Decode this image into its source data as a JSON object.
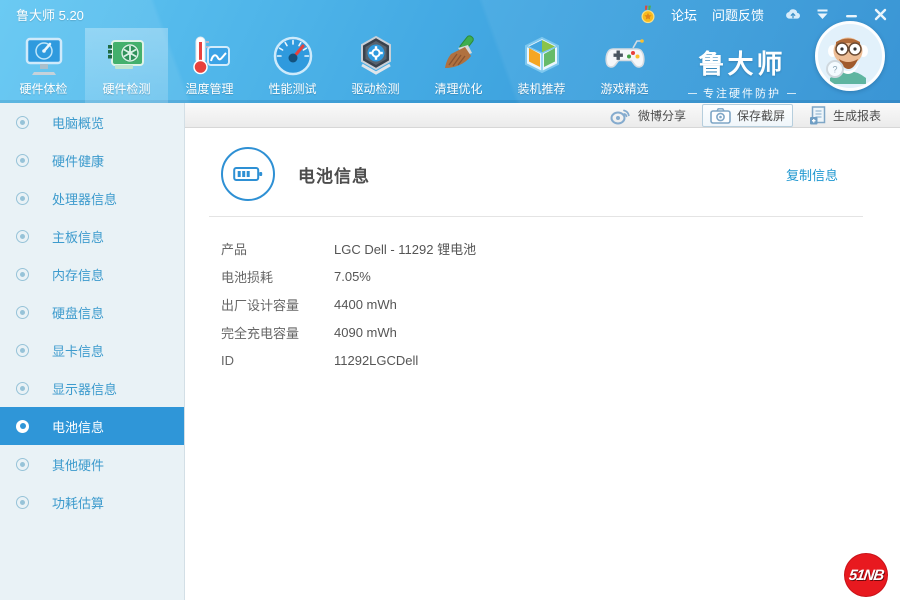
{
  "titlebar": {
    "app_title": "鲁大师 5.20",
    "medal_icon": "medal-icon",
    "links": [
      "论坛",
      "问题反馈"
    ],
    "window_icons": [
      "cloud-upload-icon",
      "collapse-icon",
      "minimize-icon",
      "close-icon"
    ]
  },
  "toolbar": {
    "items": [
      {
        "label": "硬件体检",
        "icon": "hardware-checkup-icon",
        "selected": false
      },
      {
        "label": "硬件检测",
        "icon": "hardware-test-icon",
        "selected": true
      },
      {
        "label": "温度管理",
        "icon": "temperature-icon",
        "selected": false
      },
      {
        "label": "性能测试",
        "icon": "benchmark-icon",
        "selected": false
      },
      {
        "label": "驱动检测",
        "icon": "driver-icon",
        "selected": false
      },
      {
        "label": "清理优化",
        "icon": "cleanup-icon",
        "selected": false
      },
      {
        "label": "装机推荐",
        "icon": "build-icon",
        "selected": false
      },
      {
        "label": "游戏精选",
        "icon": "games-icon",
        "selected": false
      }
    ]
  },
  "brand": {
    "name": "鲁大师",
    "tagline": "专注硬件防护",
    "avatar_icon": "mascot-avatar"
  },
  "actionbar": {
    "items": [
      {
        "label": "微博分享",
        "icon": "weibo-icon",
        "style": "plain"
      },
      {
        "label": "保存截屏",
        "icon": "camera-icon",
        "style": "button"
      },
      {
        "label": "生成报表",
        "icon": "report-icon",
        "style": "plain"
      }
    ]
  },
  "sidebar": {
    "items": [
      {
        "label": "电脑概览",
        "selected": false
      },
      {
        "label": "硬件健康",
        "selected": false
      },
      {
        "label": "处理器信息",
        "selected": false
      },
      {
        "label": "主板信息",
        "selected": false
      },
      {
        "label": "内存信息",
        "selected": false
      },
      {
        "label": "硬盘信息",
        "selected": false
      },
      {
        "label": "显卡信息",
        "selected": false
      },
      {
        "label": "显示器信息",
        "selected": false
      },
      {
        "label": "电池信息",
        "selected": true
      },
      {
        "label": "其他硬件",
        "selected": false
      },
      {
        "label": "功耗估算",
        "selected": false
      }
    ]
  },
  "main": {
    "section_title": "电池信息",
    "section_icon": "battery-icon",
    "copy_link": "复制信息",
    "rows": [
      {
        "label": "产品",
        "value": "LGC Dell - 11292 锂电池"
      },
      {
        "label": "电池损耗",
        "value": "7.05%"
      },
      {
        "label": "出厂设计容量",
        "value": "4400 mWh"
      },
      {
        "label": "完全充电容量",
        "value": "4090 mWh"
      },
      {
        "label": "ID",
        "value": "11292LGCDell"
      }
    ]
  },
  "watermark": {
    "text": "51NB"
  },
  "colors": {
    "header_light": "#60c6f2",
    "header_dark": "#2e8fd2",
    "sidebar_bg": "#e9f2f6",
    "sidebar_selected": "#2f96d8",
    "sidebar_text": "#3d9bcd",
    "link_blue": "#1e97d0",
    "watermark_red": "#e8191f"
  }
}
